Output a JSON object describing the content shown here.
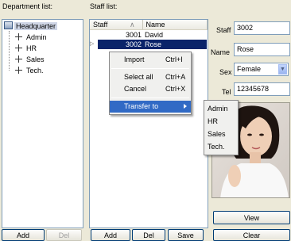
{
  "department_panel": {
    "title": "Department list:",
    "root": "Headquarter",
    "children": [
      "Admin",
      "HR",
      "Sales",
      "Tech."
    ],
    "add_label": "Add",
    "del_label": "Del"
  },
  "staff_panel": {
    "title": "Staff list:",
    "columns": [
      "Staff",
      "Name"
    ],
    "rows": [
      {
        "staff": "3001",
        "name": "David"
      },
      {
        "staff": "3002",
        "name": "Rose"
      }
    ],
    "add_label": "Add",
    "del_label": "Del",
    "save_label": "Save"
  },
  "details": {
    "staff_label": "Staff",
    "staff_value": "3002",
    "name_label": "Name",
    "name_value": "Rose",
    "sex_label": "Sex",
    "sex_value": "Female",
    "tel_label": "Tel",
    "tel_value": "12345678",
    "view_label": "View",
    "clear_label": "Clear"
  },
  "context_menu": {
    "items": [
      {
        "label": "Import",
        "shortcut": "Ctrl+I"
      },
      {
        "label": "Select all",
        "shortcut": "Ctrl+A"
      },
      {
        "label": "Cancel",
        "shortcut": "Ctrl+X"
      },
      {
        "label": "Transfer to",
        "shortcut": ""
      }
    ],
    "submenu": [
      "Admin",
      "HR",
      "Sales",
      "Tech."
    ]
  },
  "colors": {
    "window_bg": "#ece9d8",
    "selection": "#0a246a",
    "menu_highlight": "#316ac5"
  }
}
